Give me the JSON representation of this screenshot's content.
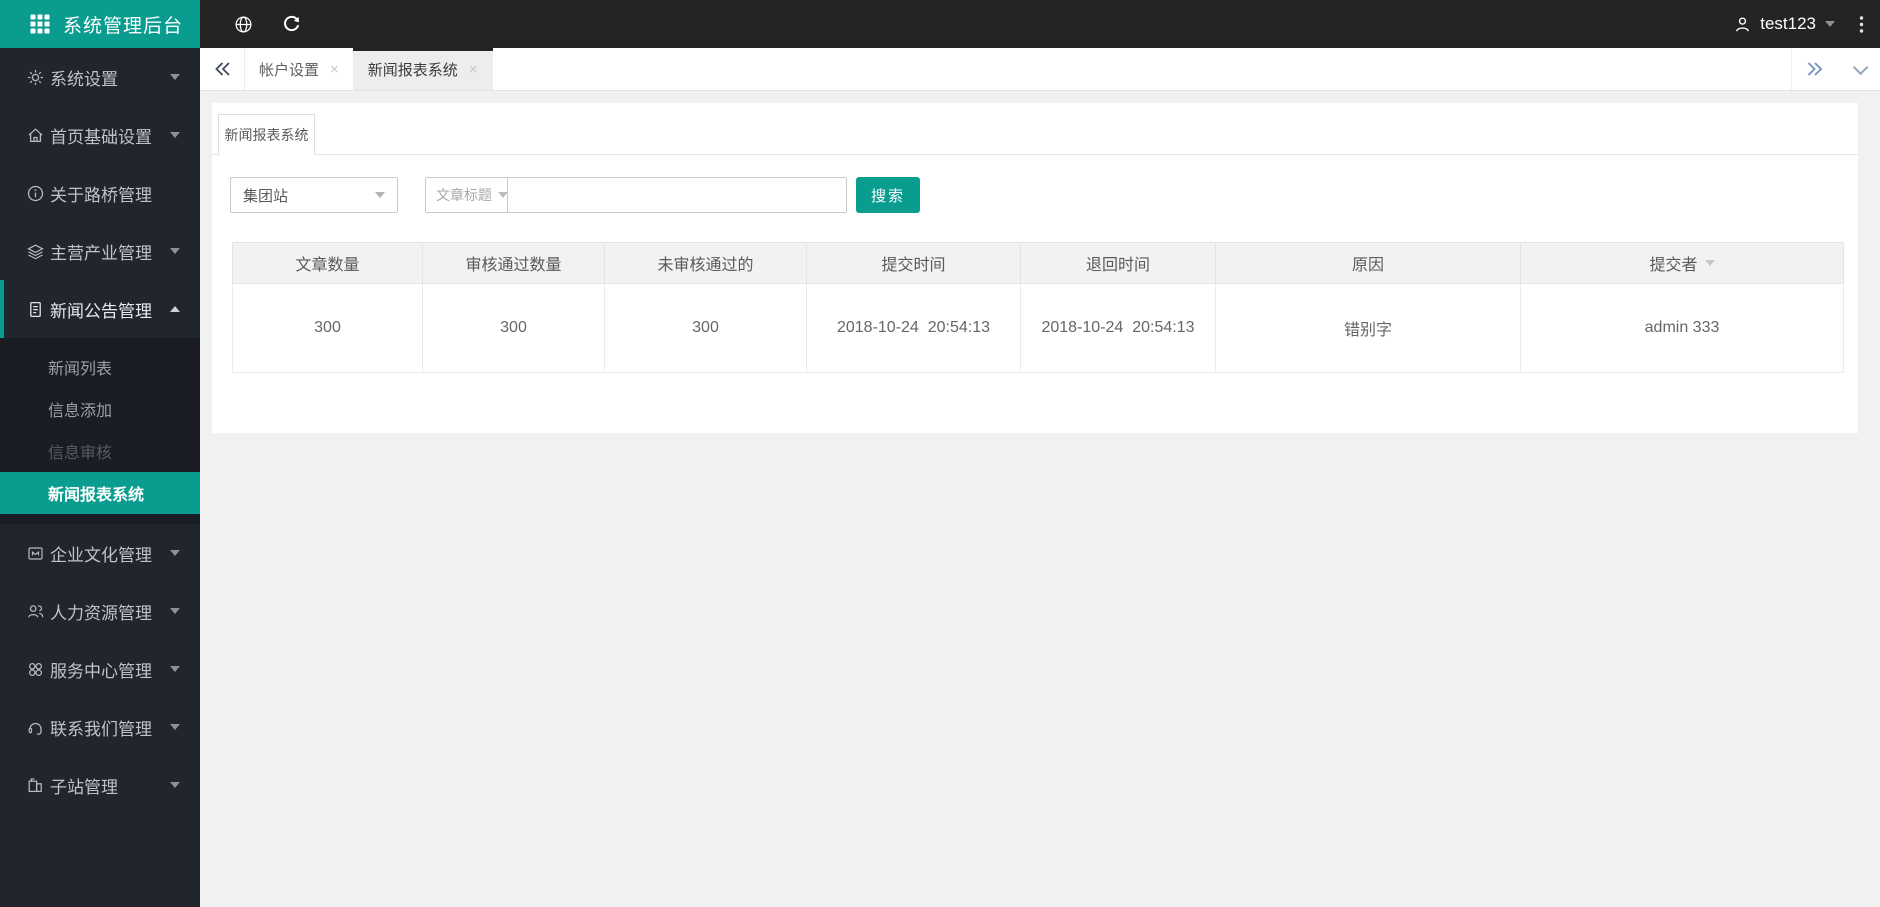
{
  "app": {
    "title": "系统管理后台"
  },
  "topbar": {
    "username": "test123",
    "icons": {
      "language": "globe-icon",
      "reload": "refresh-icon",
      "user": "user-icon",
      "more": "kebab-menu-icon"
    }
  },
  "sidebar": {
    "items": [
      {
        "label": "系统设置",
        "icon": "gear-icon",
        "arrow": "down"
      },
      {
        "label": "首页基础设置",
        "icon": "home-icon",
        "arrow": "down"
      },
      {
        "label": "关于路桥管理",
        "icon": "info-icon",
        "arrow": "none"
      },
      {
        "label": "主营产业管理",
        "icon": "layers-icon",
        "arrow": "down"
      },
      {
        "label": "新闻公告管理",
        "icon": "document-icon",
        "arrow": "up",
        "expanded": true,
        "children": [
          {
            "label": "新闻列表"
          },
          {
            "label": "信息添加"
          },
          {
            "label": "信息审核",
            "dimmed": true
          },
          {
            "label": "新闻报表系统",
            "active": true
          }
        ]
      },
      {
        "label": "企业文化管理",
        "icon": "banner-icon",
        "arrow": "down"
      },
      {
        "label": "人力资源管理",
        "icon": "people-icon",
        "arrow": "down"
      },
      {
        "label": "服务中心管理",
        "icon": "clover-icon",
        "arrow": "down"
      },
      {
        "label": "联系我们管理",
        "icon": "headset-icon",
        "arrow": "down"
      },
      {
        "label": "子站管理",
        "icon": "buildings-icon",
        "arrow": "down"
      }
    ]
  },
  "tabstrip": {
    "tabs": [
      {
        "label": "帐户设置",
        "close": "×",
        "active": false
      },
      {
        "label": "新闻报表系统",
        "close": "×",
        "active": true
      }
    ]
  },
  "panel": {
    "tab_label": "新闻报表系统"
  },
  "filters": {
    "site_value": "集团站",
    "title_field_label": "文章标题",
    "keyword_value": "",
    "search_label": "搜索"
  },
  "table": {
    "columns": [
      "文章数量",
      "审核通过数量",
      "未审核通过的",
      "提交时间",
      "退回时间",
      "原因",
      "提交者"
    ],
    "sortable_column": "提交者",
    "rows": [
      [
        "300",
        "300",
        "300",
        "2018-10-24  20:54:13",
        "2018-10-24  20:54:13",
        "错别字",
        "admin 333"
      ]
    ]
  },
  "colors": {
    "accent_teal": "#0a9d8f",
    "topbar_bg": "#242424",
    "sidebar_bg": "#21252e",
    "submenu_bg": "#1a1d23",
    "page_bg": "#f1f1f1",
    "table_header_bg": "#f2f2f2"
  }
}
